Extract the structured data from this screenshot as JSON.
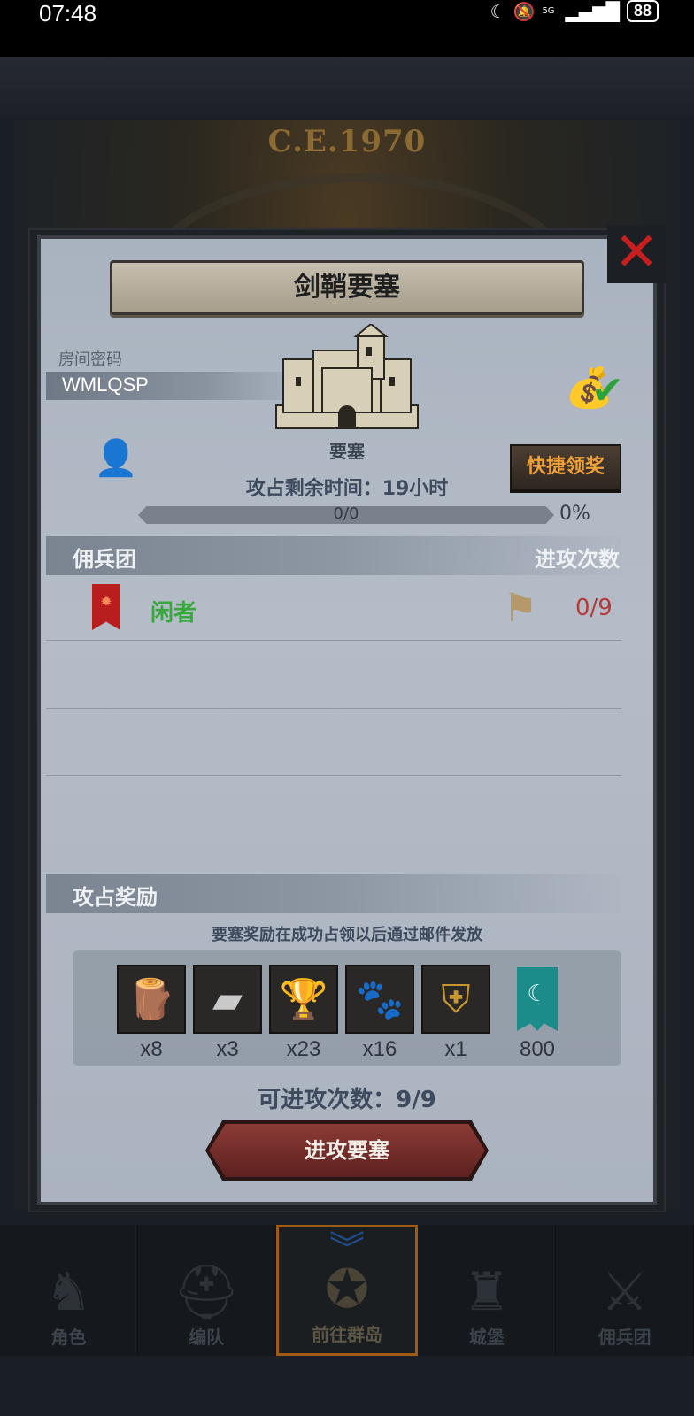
{
  "status_bar": {
    "time": "07:48",
    "battery": "88",
    "network": "5G",
    "icons": [
      "moon-icon",
      "mute-icon",
      "signal-icon",
      "battery-icon"
    ]
  },
  "background": {
    "era_label": "C.E.1970"
  },
  "modal": {
    "title": "剑鞘要塞",
    "room": {
      "label": "房间密码",
      "code": "WMLQSP"
    },
    "fortress": {
      "label": "要塞",
      "time_remaining": "攻占剩余时间：19小时"
    },
    "quick_claim_label": "快捷领奖",
    "progress": {
      "text": "0/0",
      "percent_text": "0%",
      "value": 0
    },
    "mercenary": {
      "header": "佣兵团",
      "attacks_header": "进攻次数",
      "guilds": [
        {
          "name": "闲者",
          "attacks": "0/9"
        }
      ]
    },
    "rewards": {
      "header": "攻占奖励",
      "note": "要塞奖励在成功占领以后通过邮件发放",
      "items": [
        {
          "icon": "wood-log-icon",
          "qty": "x8"
        },
        {
          "icon": "iron-ingot-icon",
          "qty": "x3"
        },
        {
          "icon": "silver-goblet-icon",
          "qty": "x23"
        },
        {
          "icon": "fur-pelt-icon",
          "qty": "x16"
        },
        {
          "icon": "knight-helmet-coin-icon",
          "qty": "x1"
        },
        {
          "icon": "guild-banner-token-icon",
          "qty": "800"
        }
      ]
    },
    "attacks_available": "可进攻次数：9/9",
    "attack_button_label": "进攻要塞"
  },
  "bottom_nav": [
    {
      "label": "角色",
      "icon": "knight-icon",
      "active": false
    },
    {
      "label": "编队",
      "icon": "helmet-icon",
      "active": false
    },
    {
      "label": "前往群岛",
      "icon": "compass-icon",
      "active": true
    },
    {
      "label": "城堡",
      "icon": "castle-icon",
      "active": false
    },
    {
      "label": "佣兵团",
      "icon": "mercenary-icon",
      "active": false
    }
  ],
  "colors": {
    "close_x": "#c81e1e",
    "guild_name": "#38a83e",
    "attack_count": "#b63a3a",
    "quick_claim_text": "#f0a23a",
    "attack_button": "#8c3b36"
  }
}
